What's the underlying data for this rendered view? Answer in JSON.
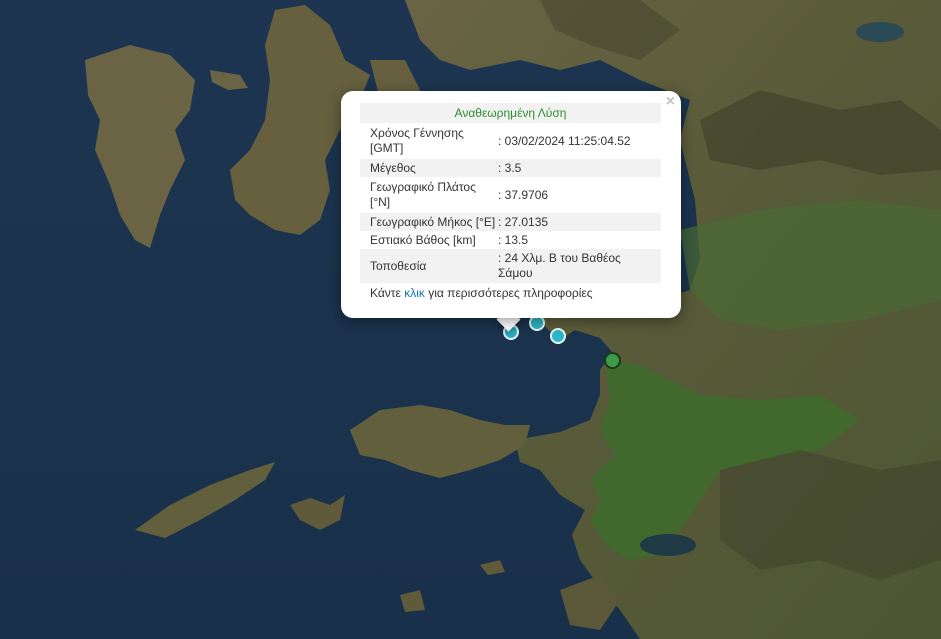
{
  "popup": {
    "title": "Αναθεωρημένη Λύση",
    "close_glyph": "×",
    "rows": [
      {
        "label": "Χρόνος Γέννησης [GMT]",
        "value": ": 03/02/2024 11:25:04.52"
      },
      {
        "label": "Μέγεθος",
        "value": ": 3.5"
      },
      {
        "label": "Γεωγραφικό Πλάτος [°N]",
        "value": ": 37.9706"
      },
      {
        "label": "Γεωγραφικό Μήκος [°E]",
        "value": ": 27.0135"
      },
      {
        "label": "Εστιακό Βάθος [km]",
        "value": ": 13.5"
      },
      {
        "label": "Τοποθεσία",
        "value": ": 24 Χλμ. Β του Βαθέος Σάμου"
      }
    ],
    "more_prefix": "Κάντε ",
    "more_link": "κλικ",
    "more_suffix": " για περισσότερες πληροφορίες"
  },
  "colors": {
    "sea": "#1b3048",
    "land": "#5b5a3a",
    "vegetation": "#3f6a2c",
    "marker_blue": "#2fb5c8",
    "marker_green": "#3d9a48",
    "title_green": "#2f8a2f",
    "link_blue": "#0b78b8"
  }
}
